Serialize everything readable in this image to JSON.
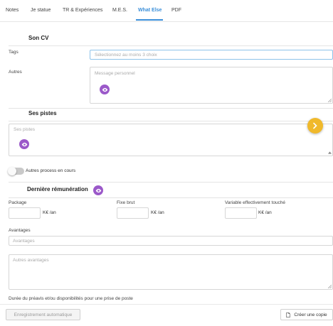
{
  "tabs": [
    {
      "label": "Notes"
    },
    {
      "label": "Je statue"
    },
    {
      "label": "TR & Expériences"
    },
    {
      "label": "M.E.S."
    },
    {
      "label": "What Else"
    },
    {
      "label": "PDF"
    }
  ],
  "active_tab": "What Else",
  "cv_section": {
    "title": "Son CV",
    "tags_label": "Tags",
    "tags_placeholder": "Sélectionnez au moins 3 choix",
    "autres_label": "Autres",
    "message_placeholder": "Message personnel"
  },
  "pistes_section": {
    "title": "Ses pistes",
    "placeholder": "Ses pistes",
    "toggle_label": "Autres process en cours"
  },
  "remuneration": {
    "title": "Dernière rémunération",
    "package_label": "Package",
    "package_unit": "K€ /an",
    "fixe_label": "Fixe brut",
    "fixe_unit": "K€ /an",
    "variable_label": "Variable effectivement touché",
    "variable_unit": "K€ /an",
    "avantages_label": "Avantages",
    "avantages_placeholder": "Avantages",
    "autres_avantages_placeholder": "Autres avantages",
    "preavis_label": "Durée du préavis et/ou disponibilités pour une prise de poste"
  },
  "footer": {
    "autosave_label": "Enregistrement automatique",
    "copy_label": "Créer une copie"
  },
  "colors": {
    "accent": "#3b8fd9",
    "eye": "#9b59c9",
    "arrow": "#f0b92b"
  }
}
